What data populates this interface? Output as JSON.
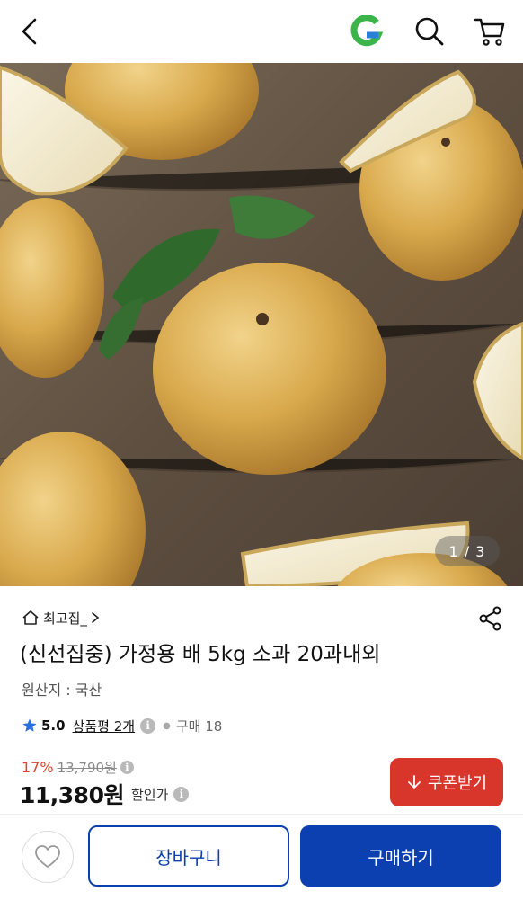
{
  "header": {
    "back_icon": "chevron-left-icon",
    "brand_icon": "gmarket-g-logo-icon",
    "search_icon": "search-icon",
    "cart_icon": "shopping-cart-icon",
    "brand_color": "#3bb54a"
  },
  "gallery": {
    "counter": "1 / 3"
  },
  "product": {
    "store_name": "최고집_",
    "title": "(신선집중) 가정용 배 5kg 소과 20과내외",
    "origin": "원산지 : 국산",
    "rating": "5.0",
    "reviews_label": "상품평 2개",
    "purchase_count": "구매 18",
    "discount_rate": "17%",
    "original_price": "13,790원",
    "sale_price": "11,380원",
    "sale_label": "할인가",
    "info_glyph": "i"
  },
  "actions": {
    "coupon_label": "쿠폰받기",
    "cart_label": "장바구니",
    "buy_label": "구매하기"
  },
  "colors": {
    "accent_blue": "#0c3fb0",
    "coupon_red": "#d9362b",
    "discount_red": "#e1422f",
    "star_blue": "#2c6fe0"
  }
}
